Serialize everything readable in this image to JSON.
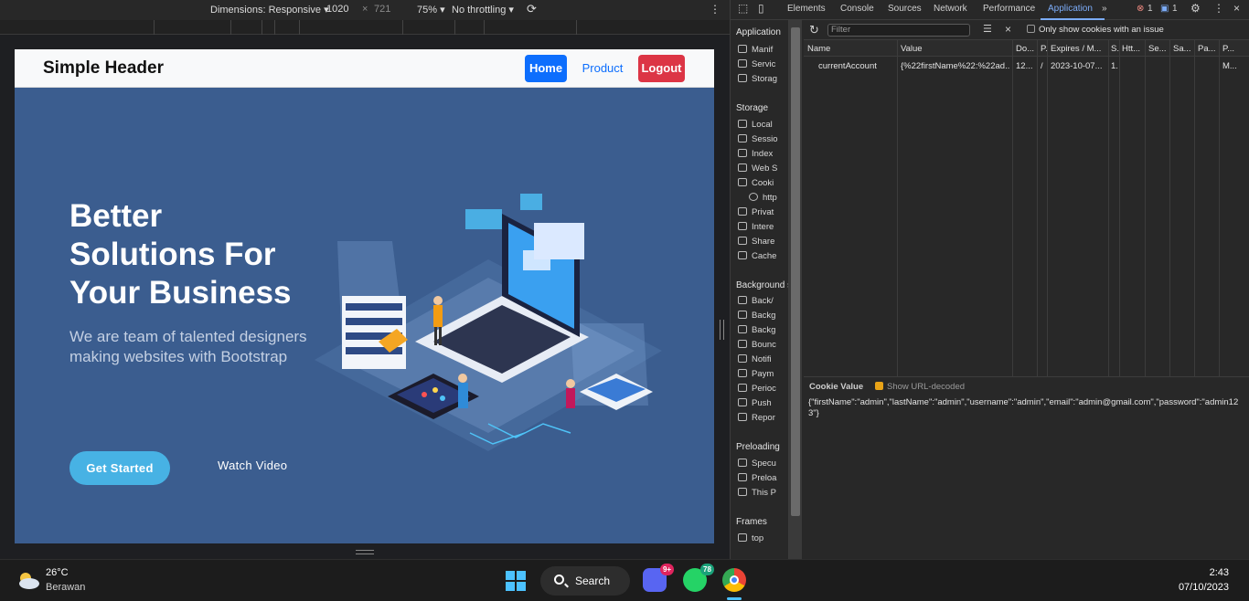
{
  "device_toolbar": {
    "dimensions_label": "Dimensions: Responsive ▾",
    "width": "1020",
    "times": "×",
    "height": "721",
    "zoom": "75% ▾",
    "throttling": "No throttling ▾"
  },
  "site": {
    "brand": "Simple Header",
    "nav": {
      "home": "Home",
      "product": "Product",
      "logout": "Logout"
    },
    "hero_title": "Better Solutions For Your Business",
    "hero_subtitle": "We are team of talented designers making websites with Bootstrap",
    "get_started": "Get Started",
    "watch_video": "Watch Video"
  },
  "devtools": {
    "tabs": [
      "Elements",
      "Console",
      "Sources",
      "Network",
      "Performance",
      "Application"
    ],
    "active_tab": "Application",
    "error_count": "1",
    "message_count": "1",
    "sidebar": {
      "application_head": "Application",
      "application_items": [
        "Manif",
        "Servic",
        "Storag"
      ],
      "storage_head": "Storage",
      "storage_items": [
        "Local",
        "Sessio",
        "Index",
        "Web S",
        "Cooki",
        "http",
        "Privat",
        "Intere",
        "Share",
        "Cache"
      ],
      "background_head": "Background s",
      "background_items": [
        "Back/",
        "Backg",
        "Backg",
        "Bounc",
        "Notifi",
        "Paym",
        "Perioc",
        "Push",
        "Repor"
      ],
      "preloading_head": "Preloading",
      "preloading_items": [
        "Specu",
        "Preloa",
        "This P"
      ],
      "frames_head": "Frames",
      "frames_items": [
        "top"
      ]
    },
    "cookies": {
      "filter_placeholder": "Filter",
      "only_issue": "Only show cookies with an issue",
      "columns": [
        "Name",
        "Value",
        "Do...",
        "P...",
        "Expires / M...",
        "S.",
        "Htt...",
        "Se...",
        "Sa...",
        "Pa...",
        "P..."
      ],
      "row": [
        "currentAccount",
        "{%22firstName%22:%22ad...",
        "12...",
        "/",
        "2023-10-07...",
        "1.",
        "",
        "",
        "",
        "",
        "M..."
      ],
      "value_title": "Cookie Value",
      "show_decoded": "Show URL-decoded",
      "decoded_value": "{\"firstName\":\"admin\",\"lastName\":\"admin\",\"username\":\"admin\",\"email\":\"admin@gmail.com\",\"password\":\"admin123\"}"
    }
  },
  "taskbar": {
    "temperature": "26°C",
    "weather": "Berawan",
    "search": "Search",
    "discord_badge": "9+",
    "whatsapp_badge": "78",
    "time": "2:43",
    "date": "07/10/2023"
  },
  "colors": {
    "hero_bg": "#3b5d8f",
    "primary": "#0d6efd",
    "danger": "#dc3545",
    "accent": "#47b2e4",
    "devtools_bg": "#282828",
    "active_tab": "#7cacf8"
  }
}
